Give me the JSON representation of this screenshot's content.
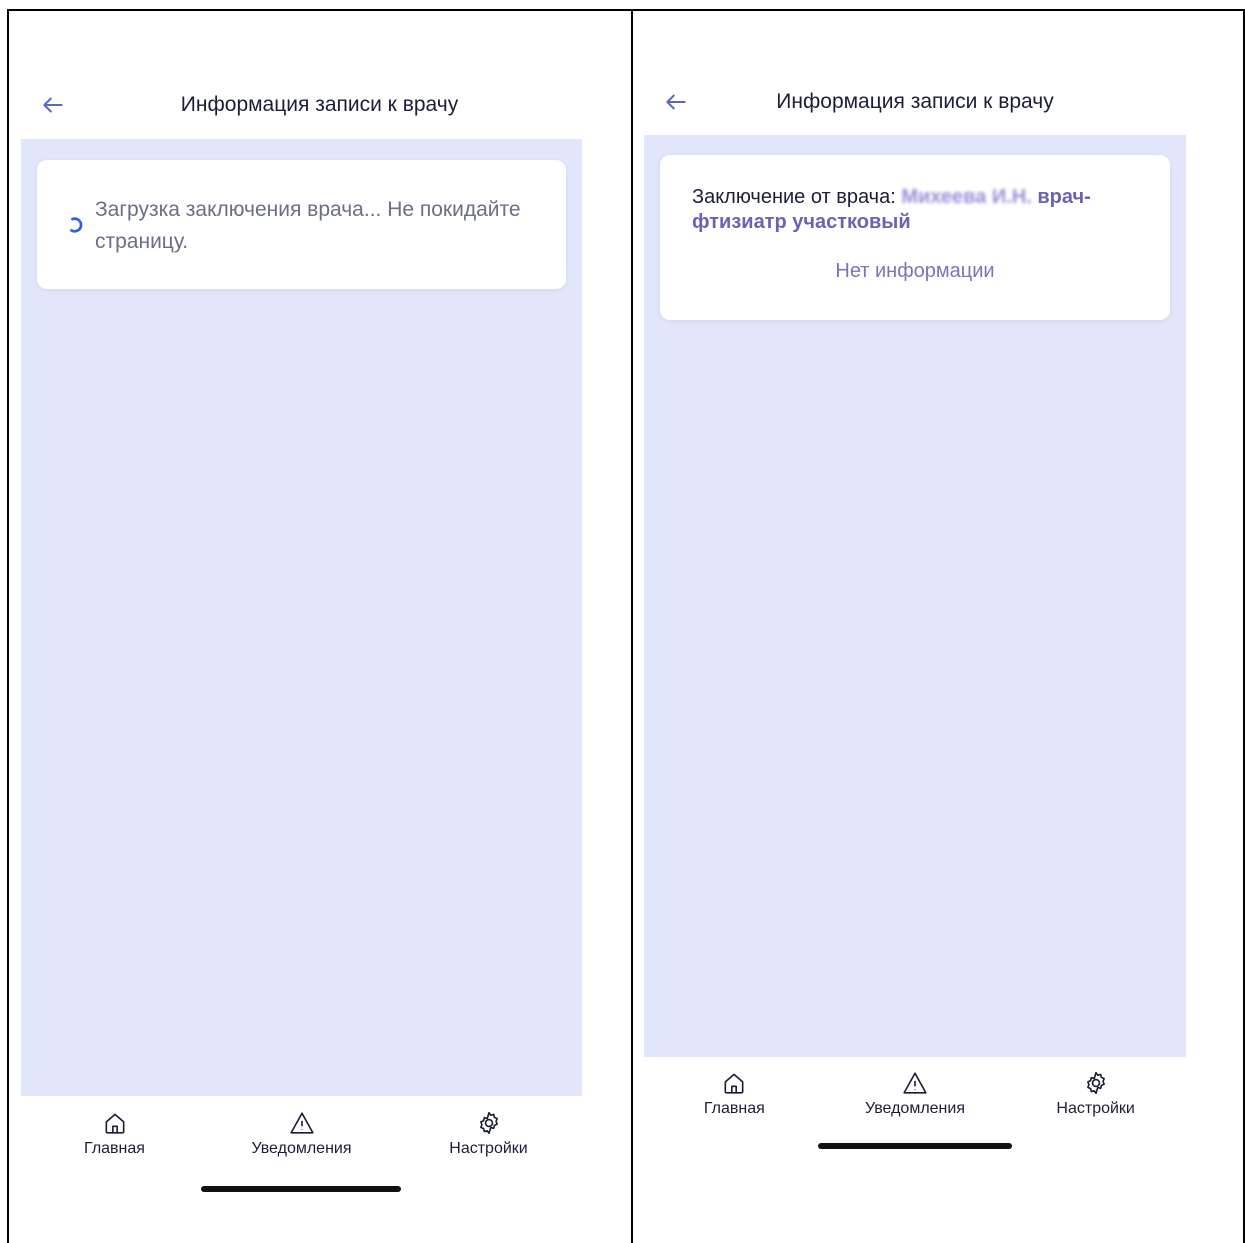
{
  "screens": [
    {
      "title": "Информация записи к врачу",
      "loading_text": "Загрузка заключения врача... Не покидайте страницу.",
      "tabs": [
        {
          "label": "Главная",
          "icon": "home-icon"
        },
        {
          "label": "Уведомления",
          "icon": "warning-icon"
        },
        {
          "label": "Настройки",
          "icon": "gear-icon"
        }
      ]
    },
    {
      "title": "Информация записи к врачу",
      "conclusion_label": "Заключение от врача: ",
      "doctor_name": "Михеева И.Н.",
      "doctor_role": " врач-фтизиатр участковый",
      "no_info": "Нет информации",
      "tabs": [
        {
          "label": "Главная",
          "icon": "home-icon"
        },
        {
          "label": "Уведомления",
          "icon": "warning-icon"
        },
        {
          "label": "Настройки",
          "icon": "gear-icon"
        }
      ]
    }
  ],
  "colors": {
    "content_bg": "#e1e6fb",
    "spinner": "#2f5fe0",
    "accent_text": "#6b62b5"
  }
}
